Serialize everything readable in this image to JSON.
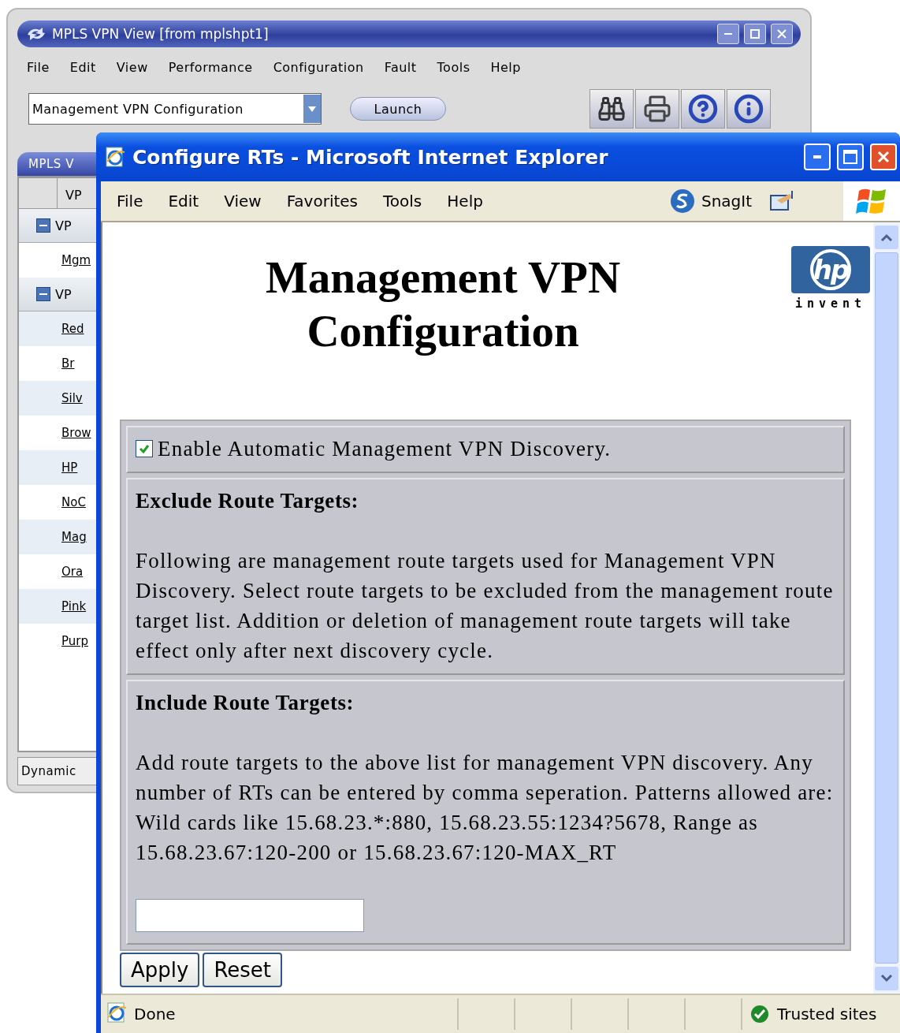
{
  "back_window": {
    "title": "MPLS VPN View [from mplshpt1]",
    "menu": [
      "File",
      "Edit",
      "View",
      "Performance",
      "Configuration",
      "Fault",
      "Tools",
      "Help"
    ],
    "view_select": {
      "value": "Management VPN Configuration"
    },
    "launch_button": "Launch",
    "panel_tab": "MPLS V",
    "table": {
      "header": "VP",
      "groups": [
        {
          "label": "VP",
          "expanded": true,
          "children": [
            {
              "label": "Mgm"
            }
          ]
        },
        {
          "label": "VP",
          "expanded": true,
          "children": [
            {
              "label": "Red"
            },
            {
              "label": "Br"
            },
            {
              "label": "Silv"
            },
            {
              "label": "Brow"
            },
            {
              "label": "HP"
            },
            {
              "label": "NoC"
            },
            {
              "label": "Mag"
            },
            {
              "label": "Ora"
            },
            {
              "label": "Pink"
            },
            {
              "label": "Purp"
            }
          ]
        }
      ]
    },
    "status": "Dynamic"
  },
  "browser": {
    "title": "Configure RTs - Microsoft Internet Explorer",
    "menu": [
      "File",
      "Edit",
      "View",
      "Favorites",
      "Tools",
      "Help"
    ],
    "snagit": "SnagIt",
    "heading": "Management VPN Configuration",
    "logo": {
      "mark": "hp",
      "tagline": "invent"
    },
    "enable_discovery": {
      "label": "Enable Automatic Management VPN Discovery.",
      "checked": true
    },
    "sections": [
      {
        "title": "Exclude Route Targets:",
        "text": "Following are management route targets used for Management VPN Discovery. Select route targets to be excluded from the management route target list. Addition or deletion of management route targets will take effect only after next discovery cycle.",
        "has_field": false
      },
      {
        "title": "Include Route Targets:",
        "text": "Add route targets to the above list for management VPN discovery. Any number of RTs can be entered by comma seperation. Patterns allowed are: Wild cards like 15.68.23.*:880, 15.68.23.55:1234?5678, Range as 15.68.23.67:120-200 or 15.68.23.67:120-MAX_RT",
        "has_field": true
      }
    ],
    "buttons": [
      "Apply",
      "Reset"
    ],
    "status": {
      "text": "Done",
      "zone": "Trusted sites"
    }
  }
}
